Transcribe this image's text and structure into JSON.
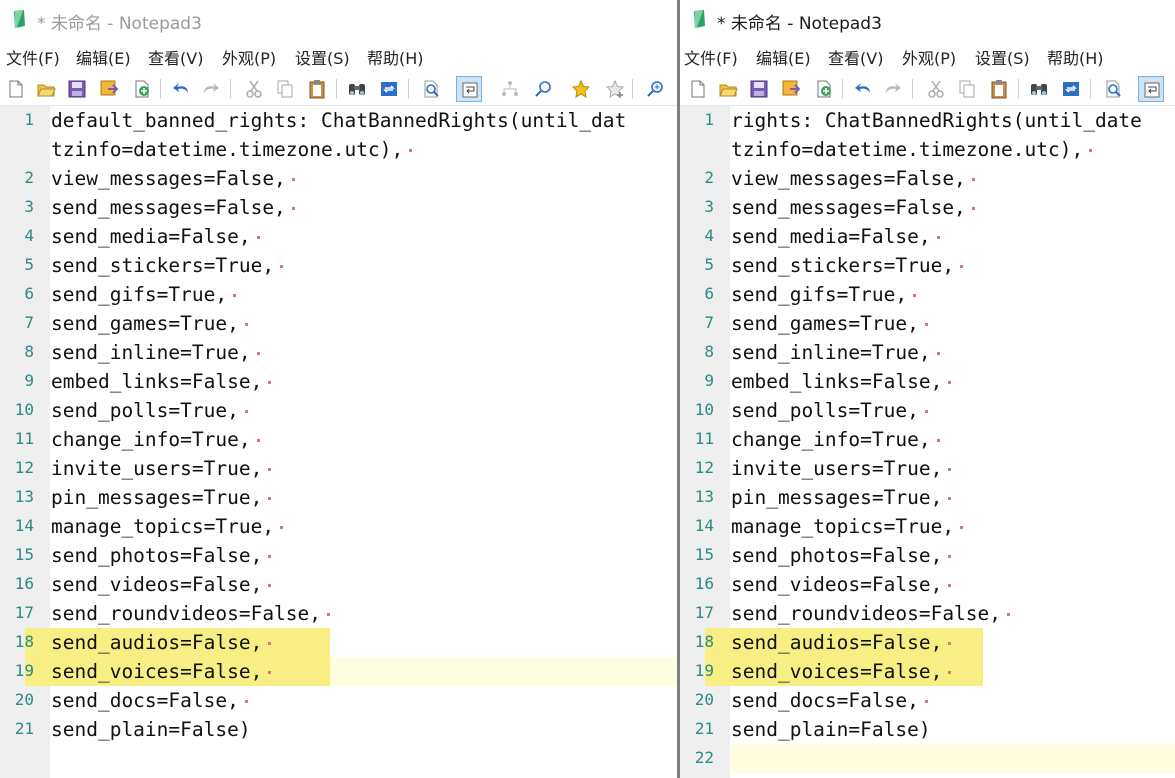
{
  "windows": [
    {
      "id": "left",
      "title": "* 未命名 - Notepad3",
      "title_active": false,
      "menu": [
        "文件(F)",
        "编辑(E)",
        "查看(V)",
        "外观(P)",
        "设置(S)",
        "帮助(H)"
      ],
      "lines": [
        {
          "num": "1",
          "text": "default_banned_rights: ChatBannedRights(until_dat",
          "cr": false
        },
        {
          "num": "",
          "text": "tzinfo=datetime.timezone.utc),",
          "cr": true
        },
        {
          "num": "2",
          "text": "view_messages=False,",
          "cr": true
        },
        {
          "num": "3",
          "text": "send_messages=False,",
          "cr": true
        },
        {
          "num": "4",
          "text": "send_media=False,",
          "cr": true
        },
        {
          "num": "5",
          "text": "send_stickers=True,",
          "cr": true
        },
        {
          "num": "6",
          "text": "send_gifs=True,",
          "cr": true
        },
        {
          "num": "7",
          "text": "send_games=True,",
          "cr": true
        },
        {
          "num": "8",
          "text": "send_inline=True,",
          "cr": true
        },
        {
          "num": "9",
          "text": "embed_links=False,",
          "cr": true
        },
        {
          "num": "10",
          "text": "send_polls=True,",
          "cr": true
        },
        {
          "num": "11",
          "text": "change_info=True,",
          "cr": true
        },
        {
          "num": "12",
          "text": "invite_users=True,",
          "cr": true
        },
        {
          "num": "13",
          "text": "pin_messages=True,",
          "cr": true
        },
        {
          "num": "14",
          "text": "manage_topics=True,",
          "cr": true
        },
        {
          "num": "15",
          "text": "send_photos=False,",
          "cr": true
        },
        {
          "num": "16",
          "text": "send_videos=False,",
          "cr": true
        },
        {
          "num": "17",
          "text": "send_roundvideos=False,",
          "cr": true
        },
        {
          "num": "18",
          "text": "send_audios=False,",
          "cr": true
        },
        {
          "num": "19",
          "text": "send_voices=False,",
          "cr": true
        },
        {
          "num": "20",
          "text": "send_docs=False,",
          "cr": true
        },
        {
          "num": "21",
          "text": "send_plain=False)",
          "cr": false
        }
      ]
    },
    {
      "id": "right",
      "title": "* 未命名 - Notepad3",
      "title_active": true,
      "menu": [
        "文件(F)",
        "编辑(E)",
        "查看(V)",
        "外观(P)",
        "设置(S)",
        "帮助(H)"
      ],
      "lines": [
        {
          "num": "1",
          "text": "rights: ChatBannedRights(until_date",
          "cr": false
        },
        {
          "num": "",
          "text": "tzinfo=datetime.timezone.utc),",
          "cr": true
        },
        {
          "num": "2",
          "text": "view_messages=False,",
          "cr": true
        },
        {
          "num": "3",
          "text": "send_messages=False,",
          "cr": true
        },
        {
          "num": "4",
          "text": "send_media=False,",
          "cr": true
        },
        {
          "num": "5",
          "text": "send_stickers=True,",
          "cr": true
        },
        {
          "num": "6",
          "text": "send_gifs=True,",
          "cr": true
        },
        {
          "num": "7",
          "text": "send_games=True,",
          "cr": true
        },
        {
          "num": "8",
          "text": "send_inline=True,",
          "cr": true
        },
        {
          "num": "9",
          "text": "embed_links=False,",
          "cr": true
        },
        {
          "num": "10",
          "text": "send_polls=True,",
          "cr": true
        },
        {
          "num": "11",
          "text": "change_info=True,",
          "cr": true
        },
        {
          "num": "12",
          "text": "invite_users=True,",
          "cr": true
        },
        {
          "num": "13",
          "text": "pin_messages=True,",
          "cr": true
        },
        {
          "num": "14",
          "text": "manage_topics=True,",
          "cr": true
        },
        {
          "num": "15",
          "text": "send_photos=False,",
          "cr": true
        },
        {
          "num": "16",
          "text": "send_videos=False,",
          "cr": true
        },
        {
          "num": "17",
          "text": "send_roundvideos=False,",
          "cr": true
        },
        {
          "num": "18",
          "text": "send_audios=False,",
          "cr": true
        },
        {
          "num": "19",
          "text": "send_voices=False,",
          "cr": true
        },
        {
          "num": "20",
          "text": "send_docs=False,",
          "cr": true
        },
        {
          "num": "21",
          "text": "send_plain=False)",
          "cr": false
        },
        {
          "num": "22",
          "text": "",
          "cr": false
        }
      ]
    }
  ],
  "toolbar_icons": [
    "new-file-icon",
    "open-folder-icon",
    "save-icon",
    "save-as-icon",
    "browse-icon",
    "undo-icon",
    "redo-icon",
    "cut-icon",
    "copy-icon",
    "paste-icon",
    "find-icon",
    "replace-icon",
    "zoom-icon",
    "word-wrap-icon",
    "tree-icon",
    "search-in-files-icon",
    "favorite-icon",
    "add-favorite-icon",
    "zoom-in-icon"
  ],
  "colors": {
    "selection": "#f7ef83",
    "current_line": "#fffde0",
    "line_number": "#2b8a84",
    "gutter": "#efefef"
  }
}
